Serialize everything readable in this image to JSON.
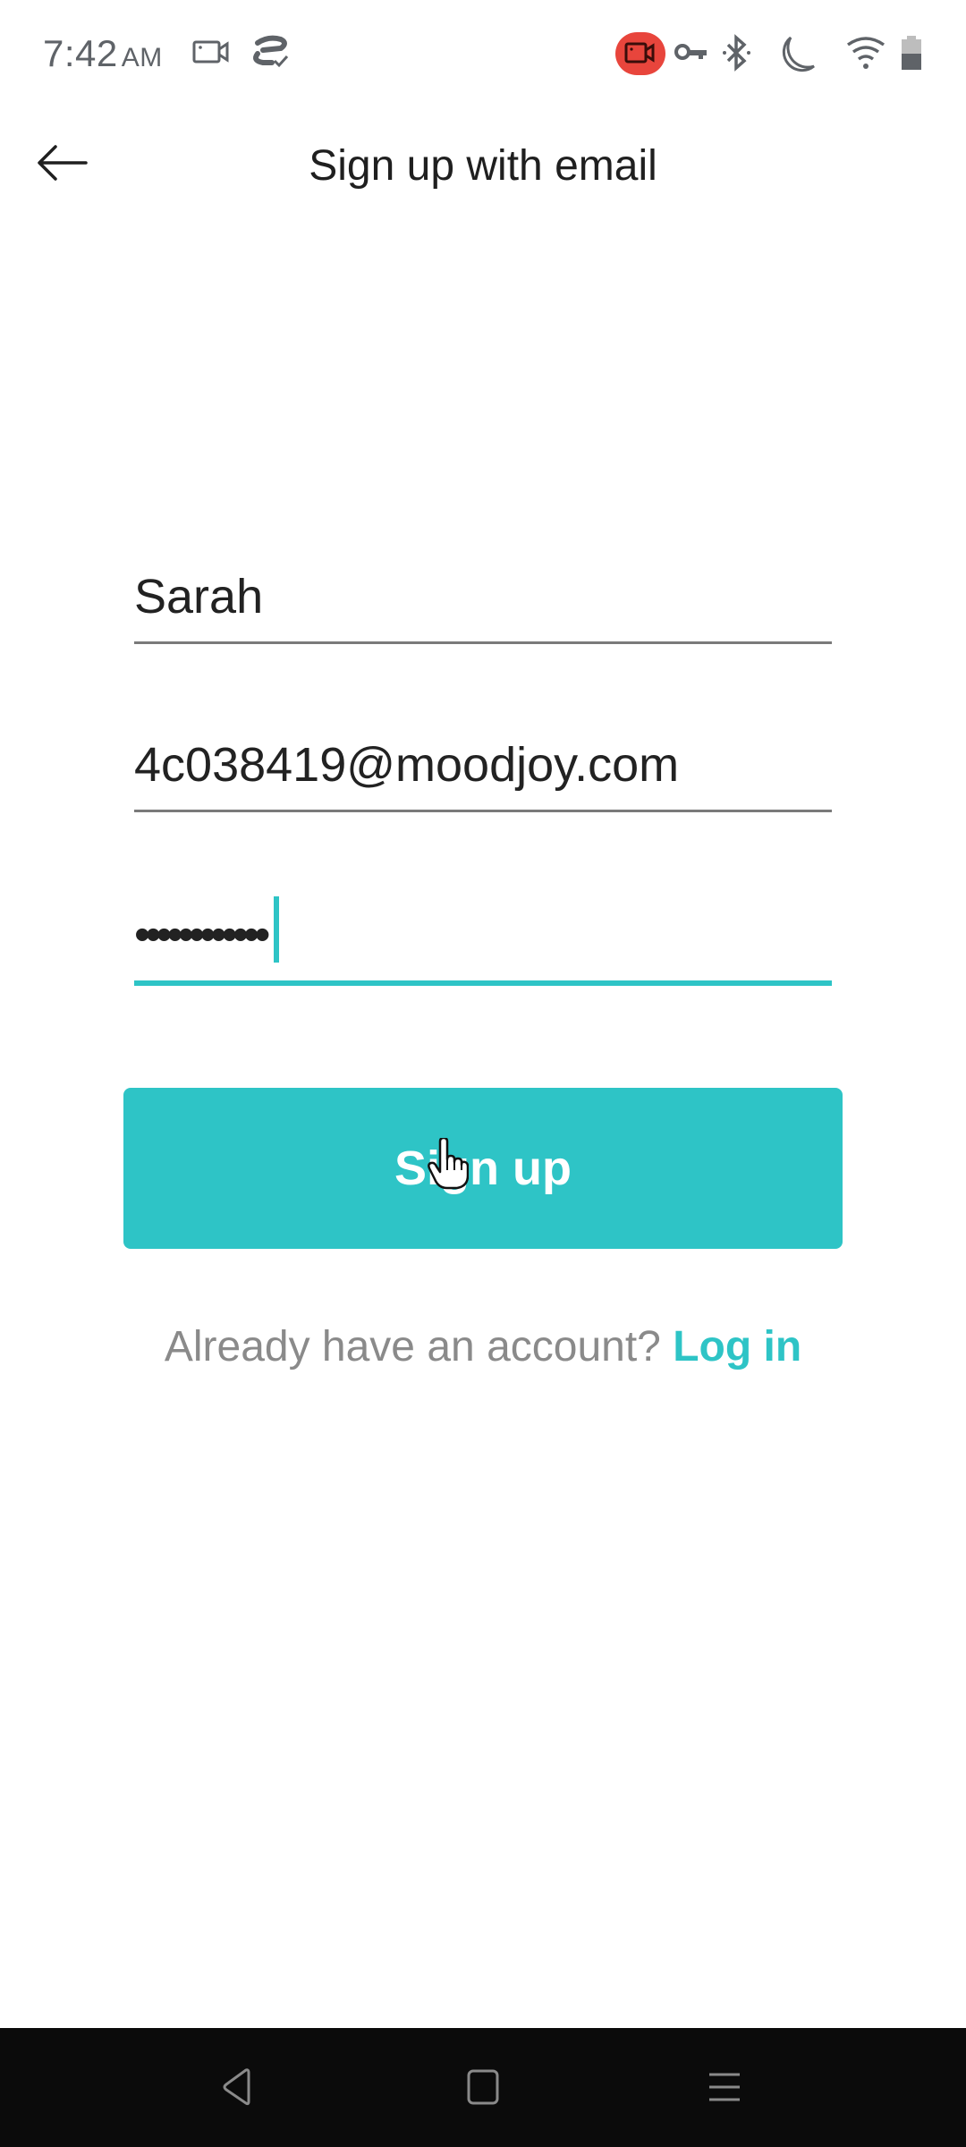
{
  "status_bar": {
    "time": "7:42",
    "ampm": "AM",
    "left_icons": [
      "screen-record-icon",
      "sync-check-icon"
    ],
    "right_icons": [
      "recording-badge-icon",
      "vpn-key-icon",
      "bluetooth-icon",
      "do-not-disturb-moon-icon",
      "wifi-icon",
      "battery-icon"
    ],
    "recording_color": "#e8453c"
  },
  "app_bar": {
    "title": "Sign up with email",
    "back_icon": "arrow-left-icon"
  },
  "form": {
    "name_value": "Sarah",
    "email_value": "4c038419@moodjoy.com",
    "password_masked": "••••••••••••",
    "focused_field": "password"
  },
  "actions": {
    "signup_label": "Sign up",
    "login_prompt": "Already have an account?",
    "login_link": "Log in"
  },
  "colors": {
    "accent": "#2ec4c6",
    "text": "#222222",
    "muted": "#8a8a8a",
    "nav_bar": "#0b0b0b"
  },
  "nav_bar": {
    "buttons": [
      "back-triangle-icon",
      "home-square-icon",
      "recents-menu-icon"
    ]
  }
}
